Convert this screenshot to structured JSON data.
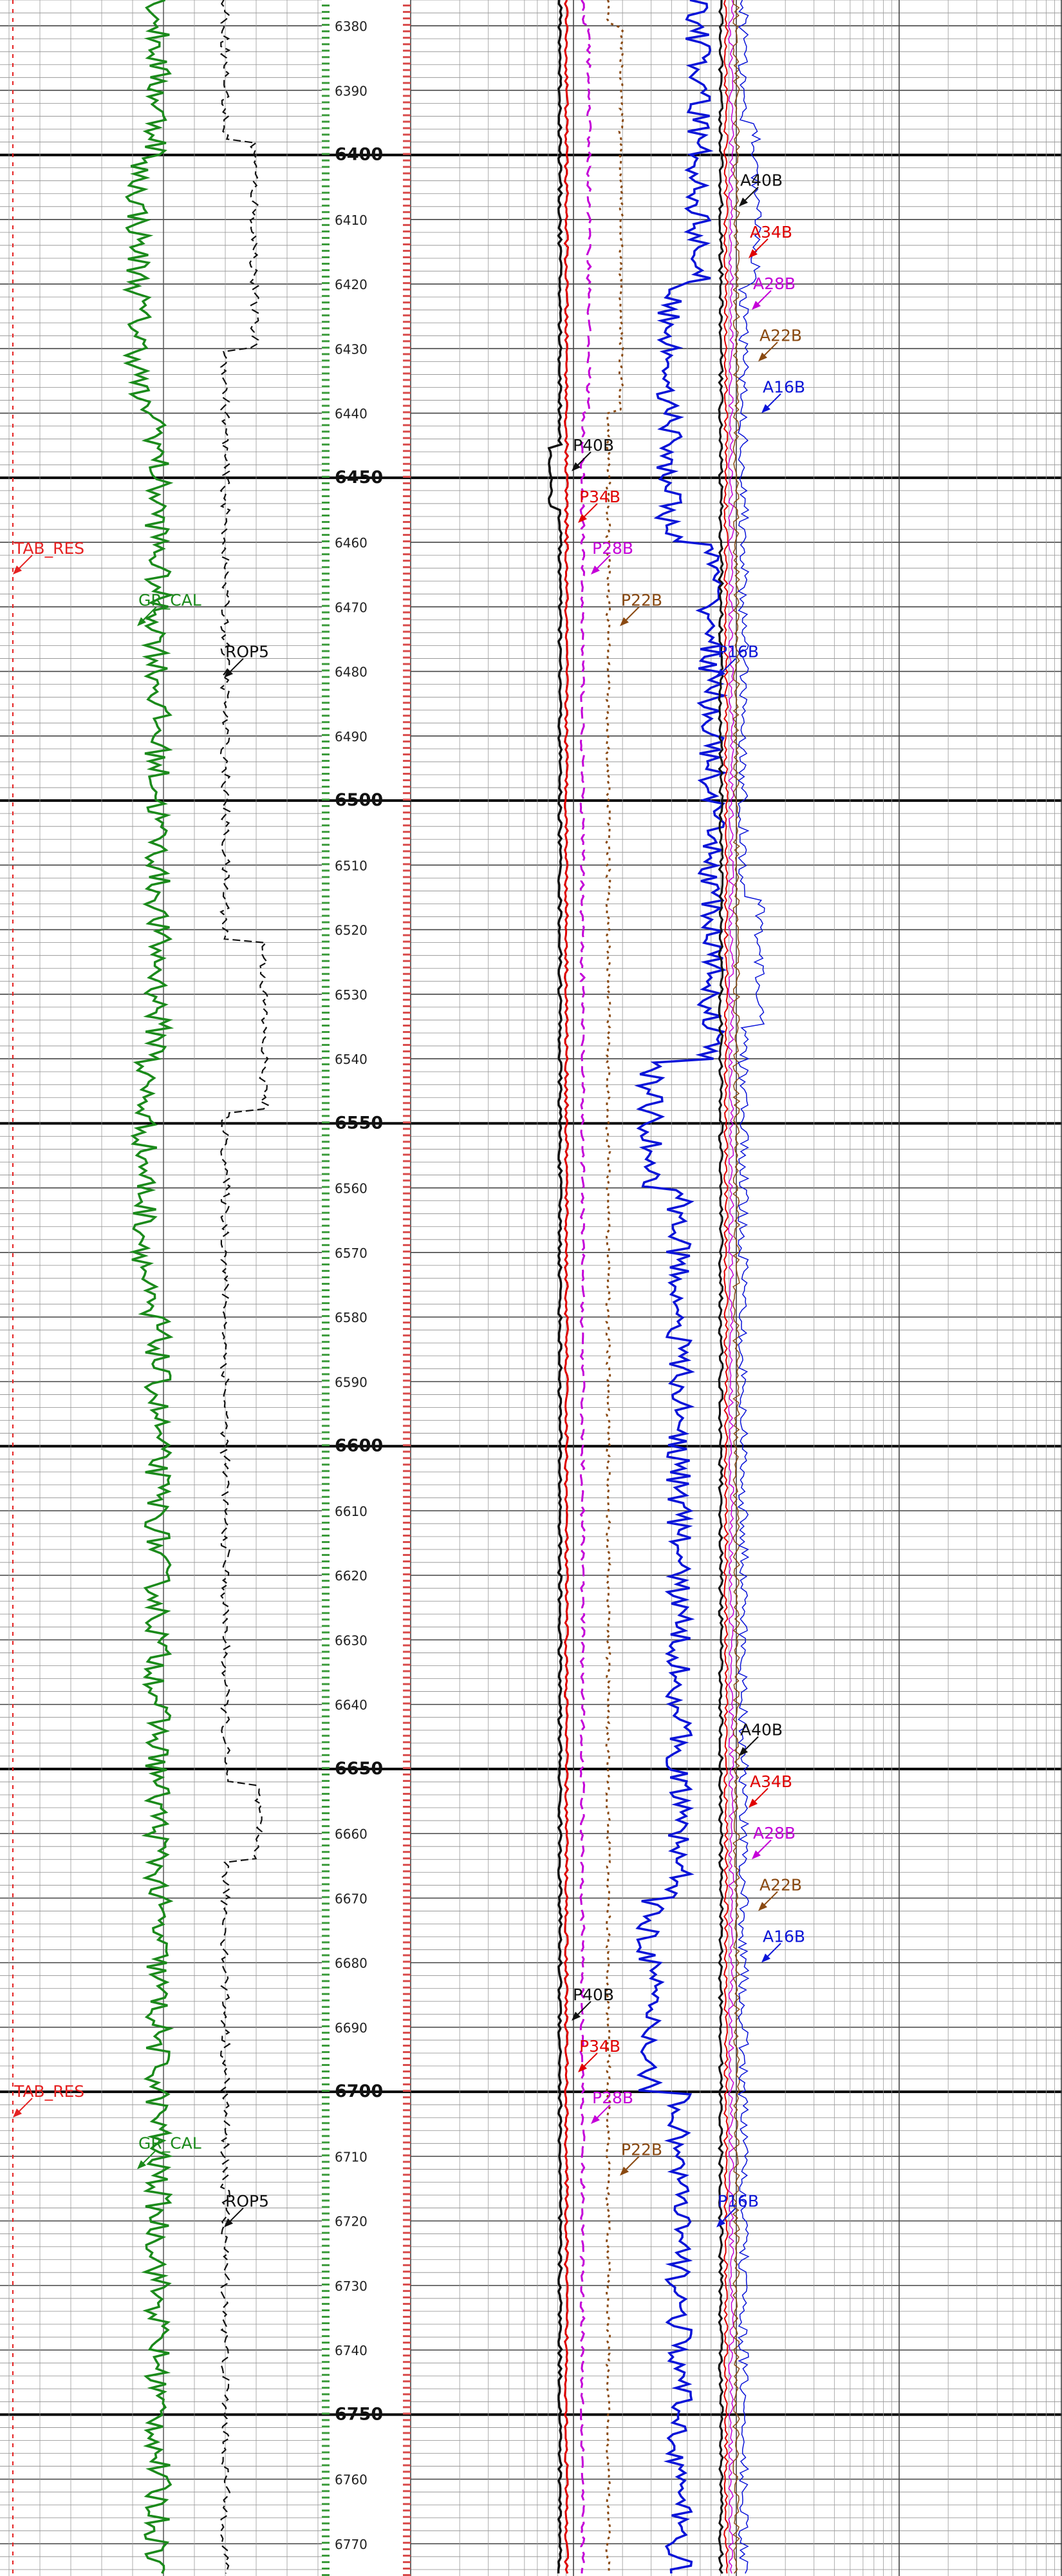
{
  "chart_data": {
    "type": "line",
    "title": "",
    "depth_axis": {
      "range": [
        6376,
        6775
      ],
      "label_step": 10,
      "major_step": 50,
      "labels": [
        "6380",
        "6390",
        "6400",
        "6410",
        "6420",
        "6430",
        "6440",
        "6450",
        "6460",
        "6470",
        "6480",
        "6490",
        "6500",
        "6510",
        "6520",
        "6530",
        "6540",
        "6550",
        "6560",
        "6570",
        "6580",
        "6590",
        "6600",
        "6610",
        "6620",
        "6630",
        "6640",
        "6650",
        "6660",
        "6670",
        "6680",
        "6690",
        "6700",
        "6710",
        "6720",
        "6730",
        "6740",
        "6750",
        "6760",
        "6770"
      ]
    },
    "grid": true,
    "resistivity_scale": "log",
    "colors": {
      "TAB_RES": "#e52222",
      "GR_CAL": "#1b8a1b",
      "ROP5": "#111111",
      "P40B": "#111111",
      "P34B": "#e00000",
      "P28B": "#c400d8",
      "P22B": "#8a4a12",
      "P16B": "#0a14d8",
      "A40B": "#111111",
      "A34B": "#e00000",
      "A28B": "#c400d8",
      "A22B": "#8a4a12",
      "A16B": "#0a14d8"
    },
    "track1": {
      "series": [
        {
          "name": "TAB_RES",
          "labels": [
            {
              "text": "TAB_RES",
              "depth": 6462
            },
            {
              "text": "TAB_RES",
              "depth": 6701
            }
          ]
        },
        {
          "name": "GR_CAL",
          "labels": [
            {
              "text": "GR_CAL",
              "depth": 6470
            },
            {
              "text": "GR_CAL",
              "depth": 6709
            }
          ]
        },
        {
          "name": "ROP5",
          "labels": [
            {
              "text": "ROP5",
              "depth": 6478
            },
            {
              "text": "ROP5",
              "depth": 6718
            }
          ]
        }
      ]
    },
    "track2": {
      "series": [
        {
          "name": "P40B",
          "labels": [
            {
              "text": "P40B",
              "depth": 6446
            },
            {
              "text": "P40B",
              "depth": 6686
            }
          ]
        },
        {
          "name": "P34B",
          "labels": [
            {
              "text": "P34B",
              "depth": 6454
            },
            {
              "text": "P34B",
              "depth": 6694
            }
          ]
        },
        {
          "name": "P28B",
          "labels": [
            {
              "text": "P28B",
              "depth": 6462
            },
            {
              "text": "P28B",
              "depth": 6702
            }
          ]
        },
        {
          "name": "P22B",
          "labels": [
            {
              "text": "P22B",
              "depth": 6470
            },
            {
              "text": "P22B",
              "depth": 6710
            }
          ]
        },
        {
          "name": "P16B",
          "labels": [
            {
              "text": "P16B",
              "depth": 6478
            },
            {
              "text": "P16B",
              "depth": 6718
            }
          ]
        },
        {
          "name": "A40B",
          "labels": [
            {
              "text": "A40B",
              "depth": 6405
            },
            {
              "text": "A40B",
              "depth": 6645
            }
          ]
        },
        {
          "name": "A34B",
          "labels": [
            {
              "text": "A34B",
              "depth": 6413
            },
            {
              "text": "A34B",
              "depth": 6653
            }
          ]
        },
        {
          "name": "A28B",
          "labels": [
            {
              "text": "A28B",
              "depth": 6421
            },
            {
              "text": "A28B",
              "depth": 6661
            }
          ]
        },
        {
          "name": "A22B",
          "labels": [
            {
              "text": "A22B",
              "depth": 6429
            },
            {
              "text": "A22B",
              "depth": 6669
            }
          ]
        },
        {
          "name": "A16B",
          "labels": [
            {
              "text": "A16B",
              "depth": 6437
            },
            {
              "text": "A16B",
              "depth": 6677
            }
          ]
        }
      ]
    }
  }
}
